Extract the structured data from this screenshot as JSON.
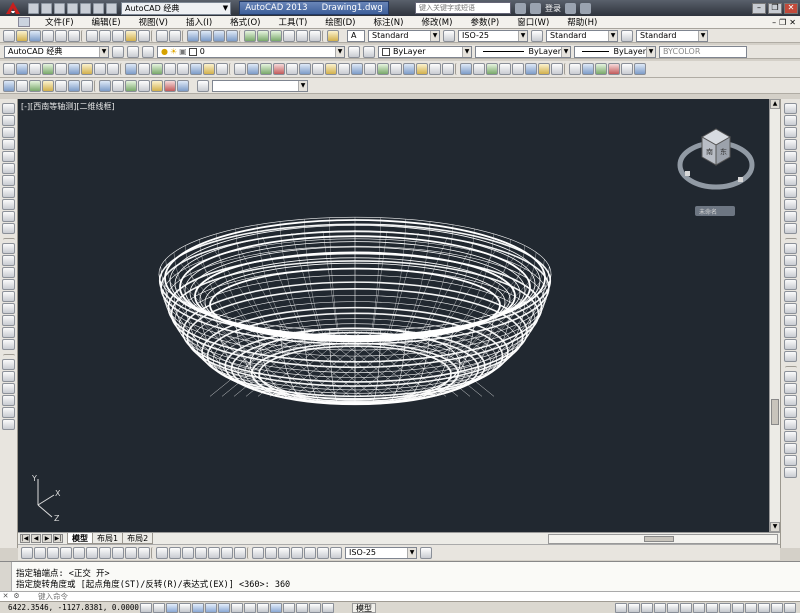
{
  "title": {
    "workspace": "AutoCAD 经典",
    "app_name": "AutoCAD 2013",
    "doc_name": "Drawing1.dwg",
    "search_placeholder": "键入关键字或短语",
    "login": "登录"
  },
  "menu": [
    "文件(F)",
    "编辑(E)",
    "视图(V)",
    "插入(I)",
    "格式(O)",
    "工具(T)",
    "绘图(D)",
    "标注(N)",
    "修改(M)",
    "参数(P)",
    "窗口(W)",
    "帮助(H)"
  ],
  "toolbar": {
    "text_style": "Standard",
    "dim_style": "ISO-25",
    "table_style": "Standard",
    "mleader_style": "Standard",
    "workspace2": "AutoCAD 经典",
    "layer": "0",
    "color": "ByLayer",
    "linetype": "ByLayer",
    "lineweight": "ByLayer",
    "plotstyle": "BYCOLOR"
  },
  "viewport": {
    "label": "[-][西南等轴测][二维线框]",
    "viewcube_text": "未命名",
    "ucs_x": "X",
    "ucs_y": "Y",
    "ucs_z": "Z"
  },
  "layout_tabs": [
    "模型",
    "布局1",
    "布局2"
  ],
  "dimbar": {
    "dim_style": "ISO-25"
  },
  "command": {
    "line1": "指定轴端点: <正交 开>",
    "line2": "指定旋转角度或 [起点角度(ST)/反转(R)/表达式(EX)] <360>: 360",
    "prompt": "键入命令"
  },
  "status": {
    "coords": "6422.3546, -1127.8381, 0.0000",
    "model_label": "模型"
  },
  "colors": {
    "viewport_bg": "#212830",
    "wireframe": "#ffffff",
    "title_bg": "#2e333b"
  },
  "icons": {
    "app_logo": "autocad-a-icon",
    "search": "search-icon",
    "user": "user-icon"
  }
}
